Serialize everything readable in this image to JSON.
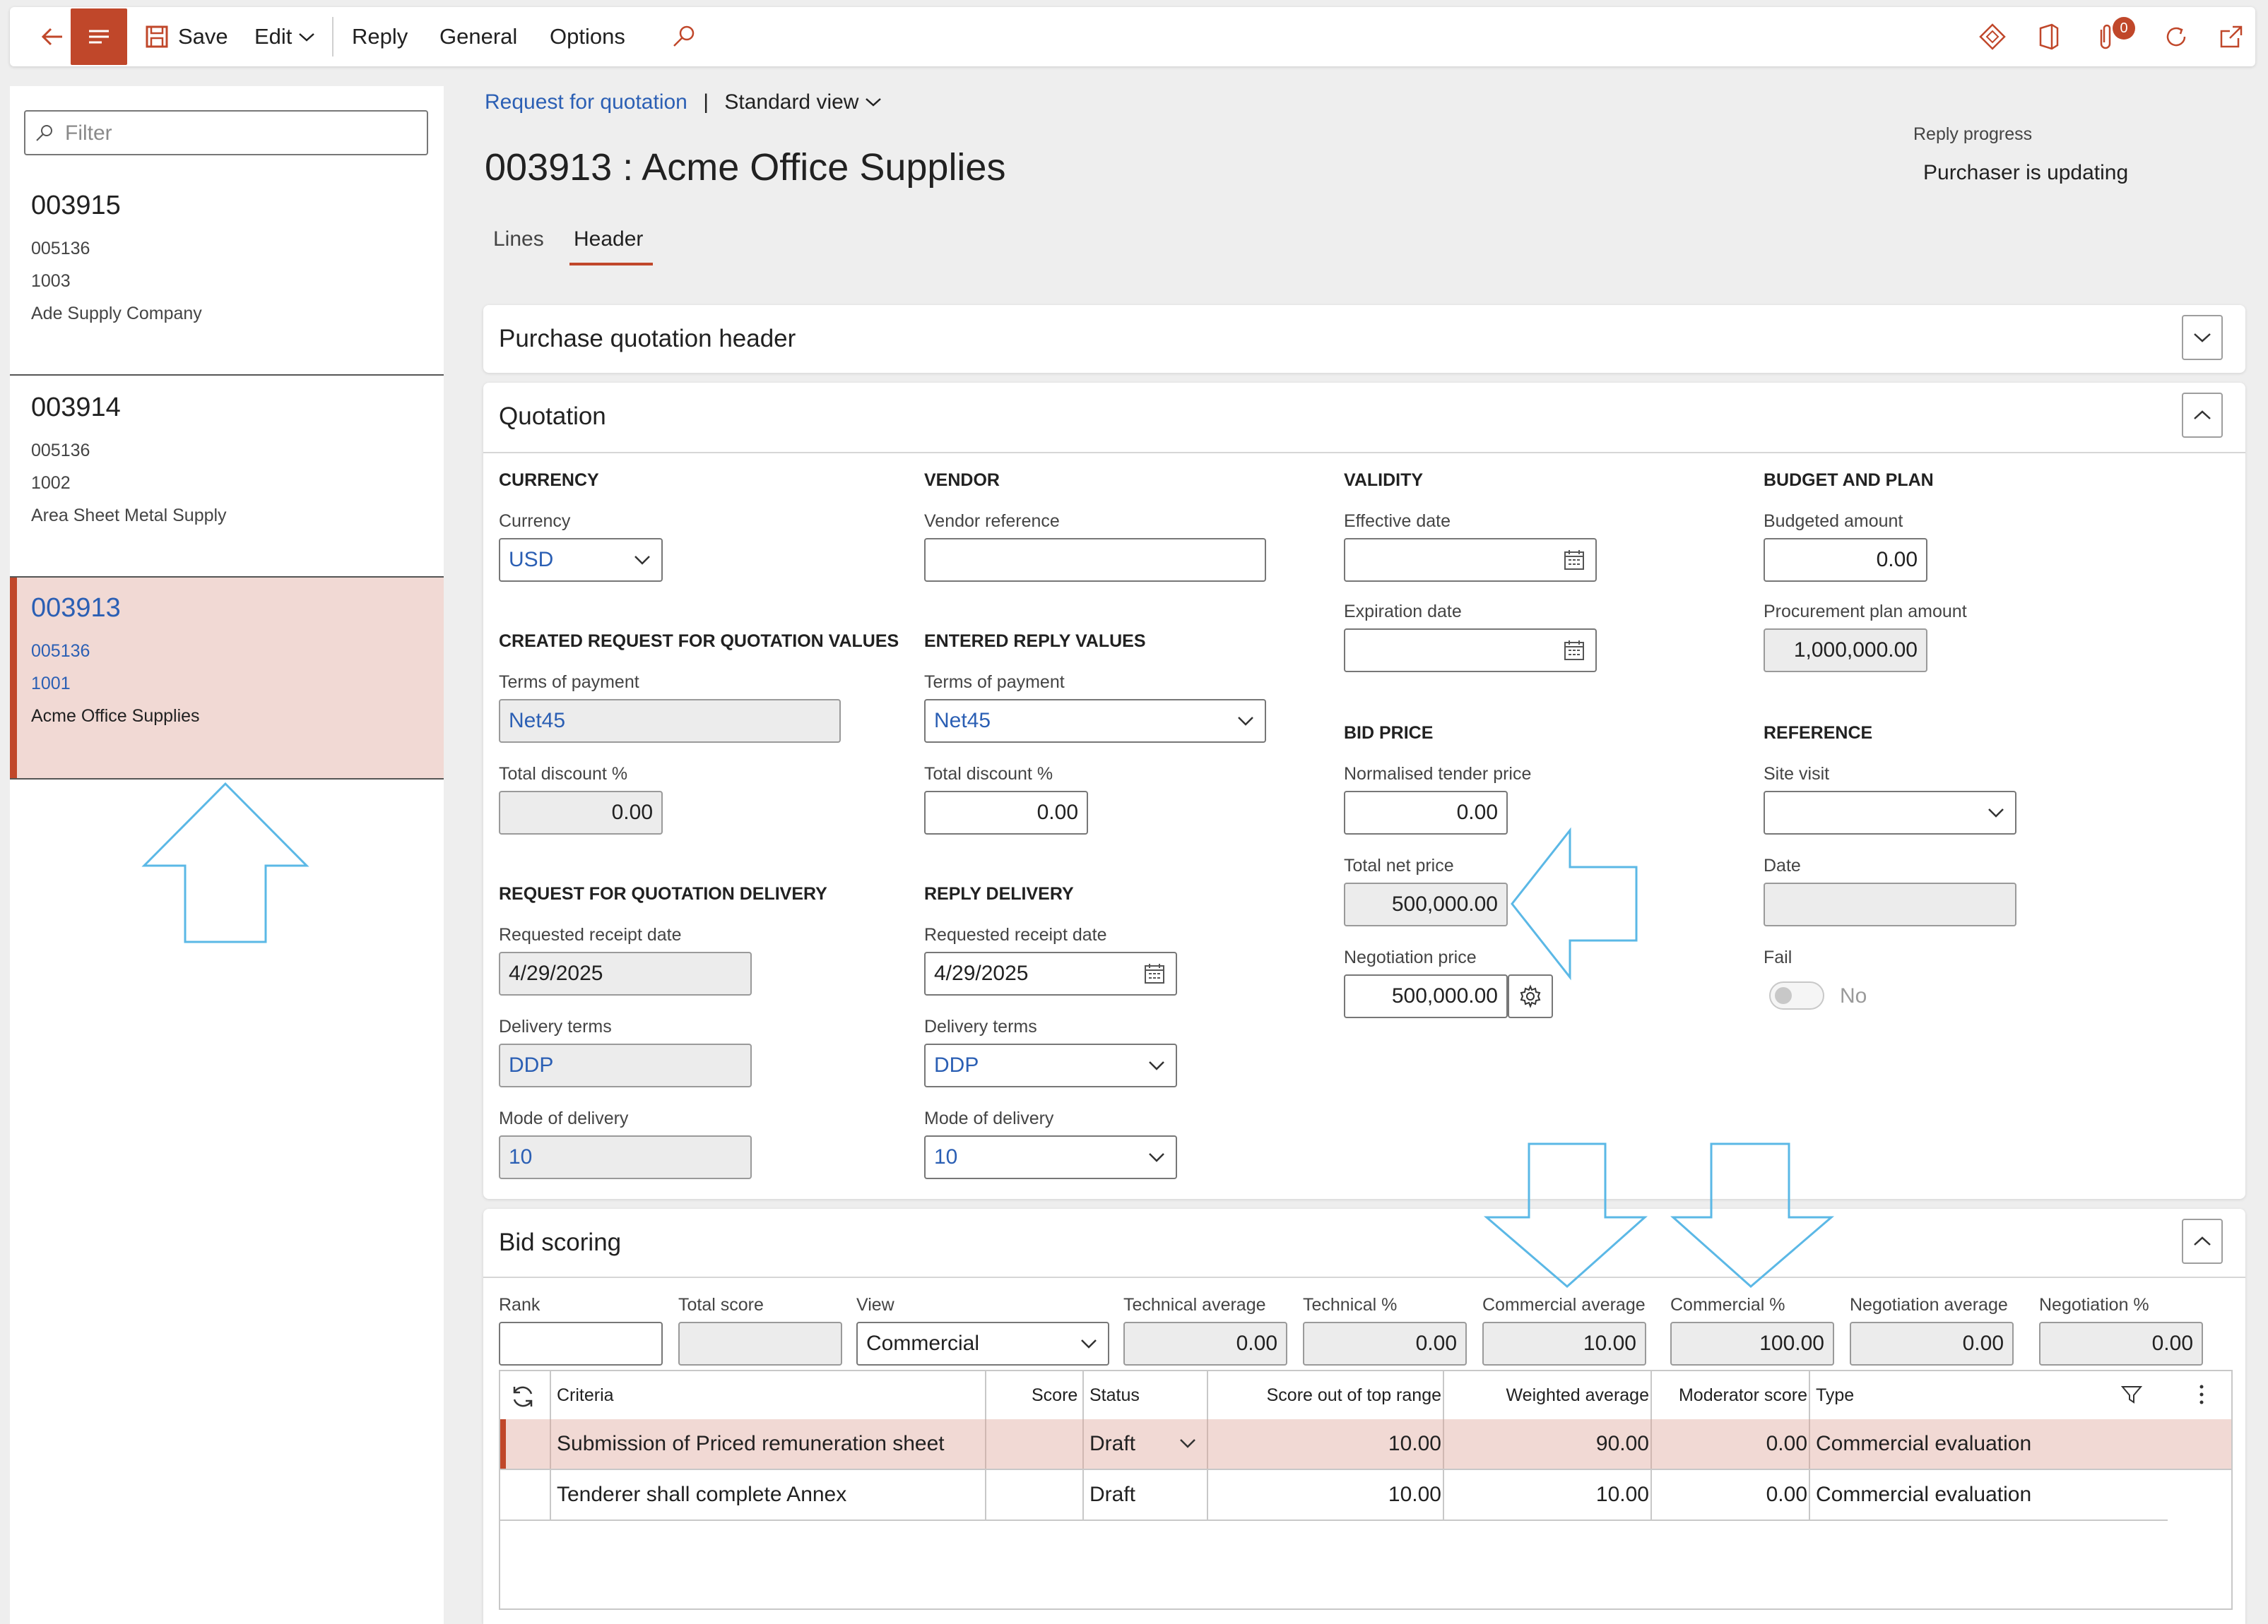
{
  "toolbar": {
    "save": "Save",
    "edit": "Edit",
    "reply": "Reply",
    "general": "General",
    "options": "Options",
    "notification_count": "0"
  },
  "filter": {
    "placeholder": "Filter"
  },
  "list": [
    {
      "id": "003915",
      "line1": "005136",
      "line2": "1003",
      "vendor": "Ade Supply Company"
    },
    {
      "id": "003914",
      "line1": "005136",
      "line2": "1002",
      "vendor": "Area Sheet Metal Supply"
    },
    {
      "id": "003913",
      "line1": "005136",
      "line2": "1001",
      "vendor": "Acme Office Supplies"
    }
  ],
  "breadcrumb": {
    "link": "Request for quotation",
    "separator": "|",
    "view": "Standard view"
  },
  "title": "003913 : Acme Office Supplies",
  "progress": {
    "label": "Reply progress",
    "value": "Purchaser is updating"
  },
  "tabs": {
    "lines": "Lines",
    "header": "Header"
  },
  "sections": {
    "purchase_header": "Purchase quotation header",
    "quotation": "Quotation",
    "bid_scoring": "Bid scoring"
  },
  "quotation": {
    "currency_group": "CURRENCY",
    "currency_label": "Currency",
    "currency_value": "USD",
    "vendor_group": "VENDOR",
    "vendor_ref_label": "Vendor reference",
    "vendor_ref_value": "",
    "validity_group": "VALIDITY",
    "effective_label": "Effective date",
    "effective_value": "",
    "expiration_label": "Expiration date",
    "expiration_value": "",
    "budget_group": "BUDGET AND PLAN",
    "budgeted_label": "Budgeted amount",
    "budgeted_value": "0.00",
    "procurement_label": "Procurement plan amount",
    "procurement_value": "1,000,000.00",
    "created_group": "CREATED REQUEST FOR QUOTATION VALUES",
    "c_terms_label": "Terms of payment",
    "c_terms_value": "Net45",
    "c_discount_label": "Total discount %",
    "c_discount_value": "0.00",
    "entered_group": "ENTERED REPLY VALUES",
    "e_terms_label": "Terms of payment",
    "e_terms_value": "Net45",
    "e_discount_label": "Total discount %",
    "e_discount_value": "0.00",
    "bid_group": "BID PRICE",
    "normalised_label": "Normalised tender price",
    "normalised_value": "0.00",
    "total_net_label": "Total net price",
    "total_net_value": "500,000.00",
    "negotiation_label": "Negotiation price",
    "negotiation_value": "500,000.00",
    "reference_group": "REFERENCE",
    "site_visit_label": "Site visit",
    "site_visit_value": "",
    "date_label": "Date",
    "date_value": "",
    "fail_label": "Fail",
    "fail_value": "No",
    "rfq_delivery_group": "REQUEST FOR QUOTATION DELIVERY",
    "r_receipt_label": "Requested receipt date",
    "r_receipt_value": "4/29/2025",
    "r_terms_label": "Delivery terms",
    "r_terms_value": "DDP",
    "r_mode_label": "Mode of delivery",
    "r_mode_value": "10",
    "reply_delivery_group": "REPLY DELIVERY",
    "p_receipt_label": "Requested receipt date",
    "p_receipt_value": "4/29/2025",
    "p_terms_label": "Delivery terms",
    "p_terms_value": "DDP",
    "p_mode_label": "Mode of delivery",
    "p_mode_value": "10"
  },
  "bid": {
    "rank_label": "Rank",
    "rank_value": "",
    "total_score_label": "Total score",
    "total_score_value": "",
    "view_label": "View",
    "view_value": "Commercial",
    "tech_avg_label": "Technical average",
    "tech_avg_value": "0.00",
    "tech_pct_label": "Technical %",
    "tech_pct_value": "0.00",
    "comm_avg_label": "Commercial average",
    "comm_avg_value": "10.00",
    "comm_pct_label": "Commercial %",
    "comm_pct_value": "100.00",
    "neg_avg_label": "Negotiation average",
    "neg_avg_value": "0.00",
    "neg_pct_label": "Negotiation %",
    "neg_pct_value": "0.00"
  },
  "grid": {
    "headers": {
      "criteria": "Criteria",
      "score": "Score",
      "status": "Status",
      "score_top": "Score out of top range",
      "weighted": "Weighted average",
      "moderator": "Moderator score",
      "type": "Type"
    },
    "rows": [
      {
        "criteria": "Submission of Priced remuneration sheet",
        "score": "",
        "status": "Draft",
        "score_top": "10.00",
        "weighted": "90.00",
        "moderator": "0.00",
        "type": "Commercial evaluation"
      },
      {
        "criteria": "Tenderer shall complete Annex",
        "score": "",
        "status": "Draft",
        "score_top": "10.00",
        "weighted": "10.00",
        "moderator": "0.00",
        "type": "Commercial evaluation"
      }
    ]
  },
  "colors": {
    "accent": "#c0472a",
    "link": "#2b5fb4",
    "selected_bg": "#f1d9d4",
    "annotation_arrow": "#5bb8e6"
  }
}
